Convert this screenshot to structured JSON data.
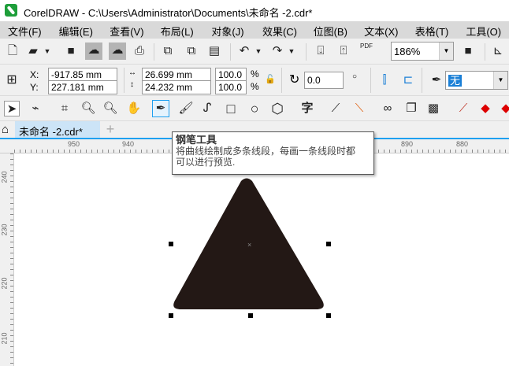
{
  "window": {
    "title": "CorelDRAW - C:\\Users\\Administrator\\Documents\\未命名 -2.cdr*"
  },
  "menu": [
    "文件(F)",
    "编辑(E)",
    "查看(V)",
    "布局(L)",
    "对象(J)",
    "效果(C)",
    "位图(B)",
    "文本(X)",
    "表格(T)",
    "工具(O)"
  ],
  "toolbar": {
    "zoom": "186%",
    "pdf_label": "PDF"
  },
  "properties": {
    "x_label": "X:",
    "y_label": "Y:",
    "x": "-917.85 mm",
    "y": "227.181 mm",
    "width": "26.699 mm",
    "height": "24.232 mm",
    "scale_x": "100.0",
    "scale_y": "100.0",
    "percent": "%",
    "rotation": "0.0",
    "outline": "无"
  },
  "tabs": {
    "document": "未命名 -2.cdr*",
    "add": "+"
  },
  "rulers": {
    "h": [
      "950",
      "940",
      "890",
      "880"
    ],
    "v": [
      "240",
      "230",
      "220",
      "210"
    ]
  },
  "tooltip": {
    "title": "钢笔工具",
    "line1": "将曲线绘制成多条线段，每画一条线段时都",
    "line2": "可以进行预览."
  },
  "shape": {
    "type": "triangle",
    "fill": "#231815"
  }
}
